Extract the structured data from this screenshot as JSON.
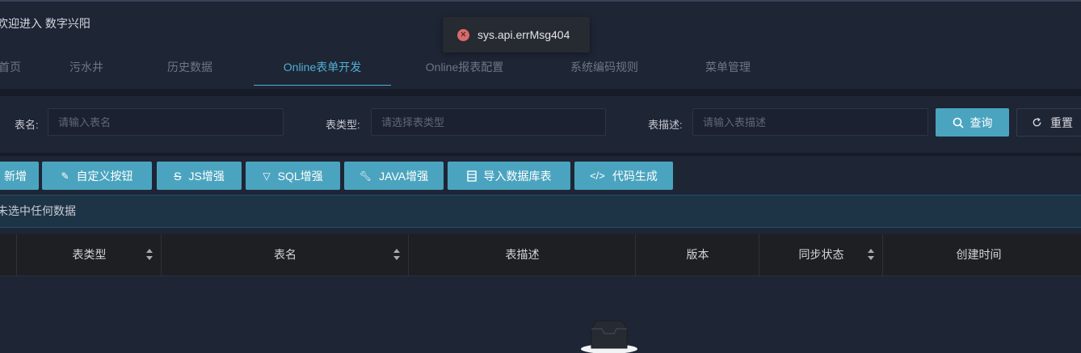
{
  "header": {
    "welcome": "欢迎进入 数字兴阳"
  },
  "tabs": [
    {
      "label": "首页",
      "active": false
    },
    {
      "label": "污水井",
      "active": false
    },
    {
      "label": "历史数据",
      "active": false
    },
    {
      "label": "Online表单开发",
      "active": true
    },
    {
      "label": "Online报表配置",
      "active": false
    },
    {
      "label": "系统编码规则",
      "active": false
    },
    {
      "label": "菜单管理",
      "active": false
    }
  ],
  "toast": {
    "icon": "error-icon",
    "message": "sys.api.errMsg404"
  },
  "search": {
    "table_name_label": "表名:",
    "table_name_placeholder": "请输入表名",
    "table_type_label": "表类型:",
    "table_type_placeholder": "请选择表类型",
    "table_desc_label": "表描述:",
    "table_desc_placeholder": "请输入表描述",
    "query_label": "查询",
    "reset_label": "重置"
  },
  "toolbar": {
    "add_label": "新增",
    "custom_button_label": "自定义按钮",
    "js_label": "JS增强",
    "sql_label": "SQL增强",
    "java_label": "JAVA增强",
    "import_db_label": "导入数据库表",
    "codegen_label": "代码生成"
  },
  "selection_alert": "未选中任何数据",
  "table": {
    "columns": [
      "表类型",
      "表名",
      "表描述",
      "版本",
      "同步状态",
      "创建时间"
    ]
  },
  "colors": {
    "background": "#1e2535",
    "accent": "#4ba4bf",
    "active_tab": "#4fb0d3",
    "error": "#d86b6b"
  }
}
